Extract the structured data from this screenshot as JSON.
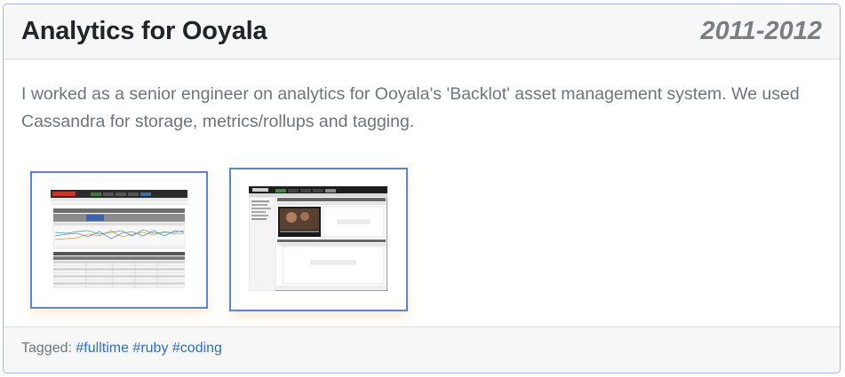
{
  "header": {
    "title": "Analytics for Ooyala",
    "years": "2011-2012"
  },
  "body": {
    "description": "I worked as a senior engineer on analytics for Ooyala's 'Backlot' asset management system. We used Cassandra for storage, metrics/rollups and tagging."
  },
  "thumbnails": [
    {
      "depicts": "analytics dashboard screenshot with line chart and data table"
    },
    {
      "depicts": "Backlot asset manager screenshot with video player"
    }
  ],
  "footer": {
    "label": "Tagged:",
    "tags": [
      "#fulltime",
      "#ruby",
      "#coding"
    ]
  },
  "colors": {
    "border": "#a9b8d6",
    "header_bg": "#f7f7f7",
    "title": "#212529",
    "muted": "#6c757d",
    "link": "#2f6fb8",
    "thumb_border": "#5f83cc"
  }
}
